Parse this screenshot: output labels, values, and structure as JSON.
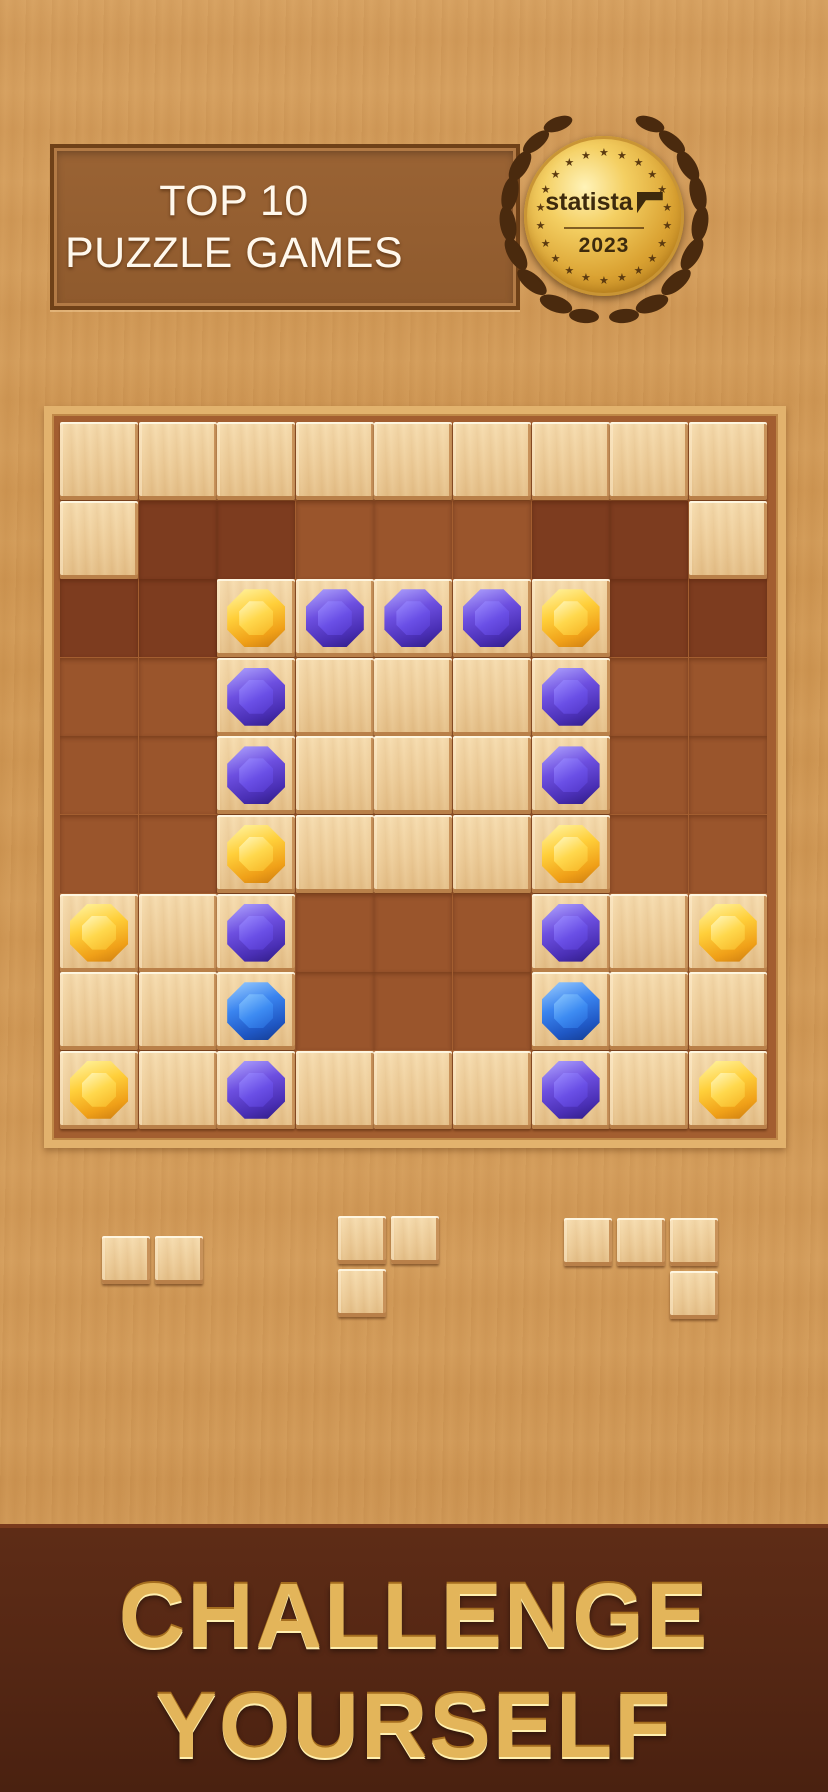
{
  "banner": {
    "line1": "TOP 10",
    "line2": "PUZZLE GAMES"
  },
  "award": {
    "brand": "statista",
    "year": "2023",
    "icon": "laurel-medal-icon"
  },
  "board": {
    "size": 9,
    "legend": {
      "T": "wood-tile",
      "G": "gold-gem",
      "P": "purple-gem",
      "B": "blue-gem",
      "E": "empty-slot",
      "D": "empty-slot-dark"
    },
    "rows": [
      [
        "T",
        "T",
        "T",
        "T",
        "T",
        "T",
        "T",
        "T",
        "T"
      ],
      [
        "T",
        "D",
        "D",
        "E",
        "E",
        "E",
        "D",
        "D",
        "T"
      ],
      [
        "D",
        "D",
        "G",
        "P",
        "P",
        "P",
        "G",
        "D",
        "D"
      ],
      [
        "E",
        "E",
        "P",
        "T",
        "T",
        "T",
        "P",
        "E",
        "E"
      ],
      [
        "E",
        "E",
        "P",
        "T",
        "T",
        "T",
        "P",
        "E",
        "E"
      ],
      [
        "E",
        "E",
        "G",
        "T",
        "T",
        "T",
        "G",
        "E",
        "E"
      ],
      [
        "G",
        "T",
        "P",
        "E",
        "E",
        "E",
        "P",
        "T",
        "G"
      ],
      [
        "T",
        "T",
        "B",
        "E",
        "E",
        "E",
        "B",
        "T",
        "T"
      ],
      [
        "G",
        "T",
        "P",
        "T",
        "T",
        "T",
        "P",
        "T",
        "G"
      ]
    ]
  },
  "tray": {
    "pieces": [
      {
        "name": "piece-horizontal-2",
        "cells": [
          [
            0,
            0
          ],
          [
            1,
            0
          ]
        ]
      },
      {
        "name": "piece-zigzag",
        "cells": [
          [
            0,
            0
          ],
          [
            1,
            0
          ],
          [
            0,
            1
          ]
        ]
      },
      {
        "name": "piece-corner",
        "cells": [
          [
            0,
            0
          ],
          [
            1,
            0
          ],
          [
            2,
            0
          ],
          [
            2,
            1
          ]
        ]
      }
    ]
  },
  "headline": {
    "line1": "CHALLENGE",
    "line2": "YOURSELF"
  },
  "colors": {
    "background": "#d29a58",
    "board_frame": "#e2b26d",
    "slot": "#9a552c",
    "slot_dark": "#7d3c1f",
    "headline_gold": "#e3b55a",
    "bottom_band": "#552714"
  }
}
